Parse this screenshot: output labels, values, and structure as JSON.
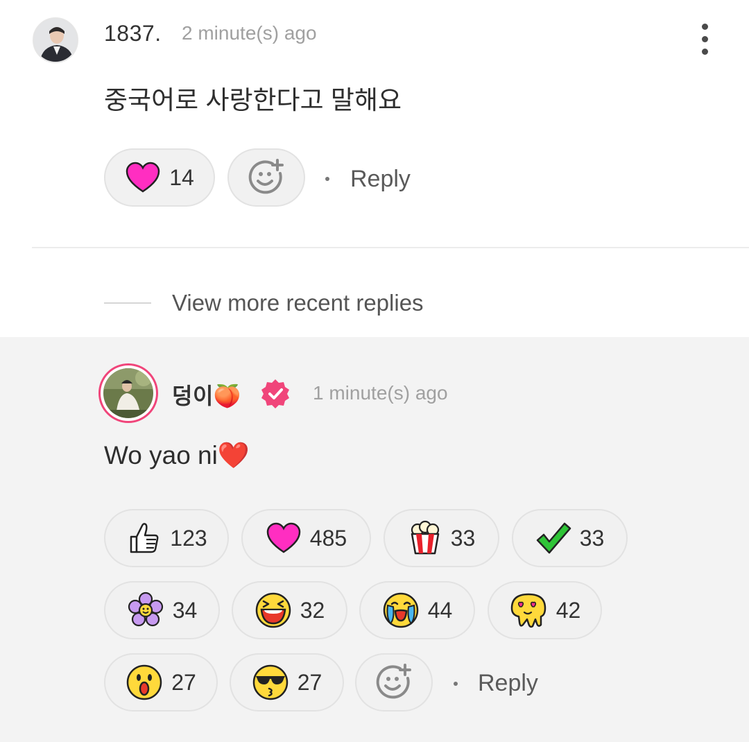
{
  "comment": {
    "author": "1837.",
    "time": "2 minute(s) ago",
    "text": "중국어로 사랑한다고 말해요",
    "reactions": [
      {
        "icon": "heart-icon",
        "count": "14"
      }
    ],
    "reply_label": "Reply"
  },
  "view_more_label": "View more recent replies",
  "reply": {
    "author": "덩이🍑",
    "verified": true,
    "time": "1 minute(s) ago",
    "text": "Wo yao ni❤️",
    "reactions": [
      {
        "icon": "thumbs-up-icon",
        "count": "123"
      },
      {
        "icon": "heart-icon",
        "count": "485"
      },
      {
        "icon": "popcorn-icon",
        "count": "33"
      },
      {
        "icon": "checkmark-icon",
        "count": "33"
      },
      {
        "icon": "flower-icon",
        "count": "34"
      },
      {
        "icon": "laughing-face-icon",
        "count": "32"
      },
      {
        "icon": "crying-face-icon",
        "count": "44"
      },
      {
        "icon": "melting-heart-eyes-icon",
        "count": "42"
      },
      {
        "icon": "surprised-face-icon",
        "count": "27"
      },
      {
        "icon": "cool-kiss-face-icon",
        "count": "27"
      }
    ],
    "reply_label": "Reply"
  },
  "colors": {
    "heart": "#ff2ec1",
    "verified_badge": "#f0457a",
    "avatar_ring": "#f0457a",
    "panel_bg": "#f3f3f3"
  }
}
